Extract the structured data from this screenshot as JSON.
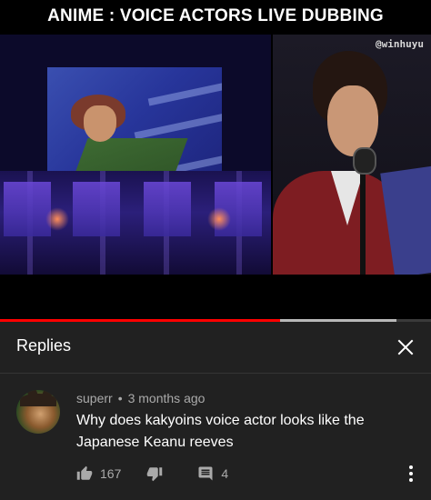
{
  "video": {
    "title": "ANIME :  VOICE ACTORS LIVE DUBBING",
    "watermark": "@winhuyu",
    "progress": {
      "played_fraction": 0.65,
      "buffered_fraction": 0.92
    }
  },
  "replies": {
    "title": "Replies",
    "close_icon": "close-icon"
  },
  "comment": {
    "author": "superr",
    "separator": "•",
    "time": "3 months ago",
    "text": "Why does kakyoins voice actor looks like the Japanese Keanu reeves",
    "likes": "167",
    "replies": "4",
    "icons": [
      "thumb-up-icon",
      "thumb-down-icon",
      "reply-icon",
      "more-vertical-icon"
    ]
  },
  "colors": {
    "background": "#212121",
    "progress_played": "#ff0000",
    "meta_text": "#aaaaaa"
  }
}
